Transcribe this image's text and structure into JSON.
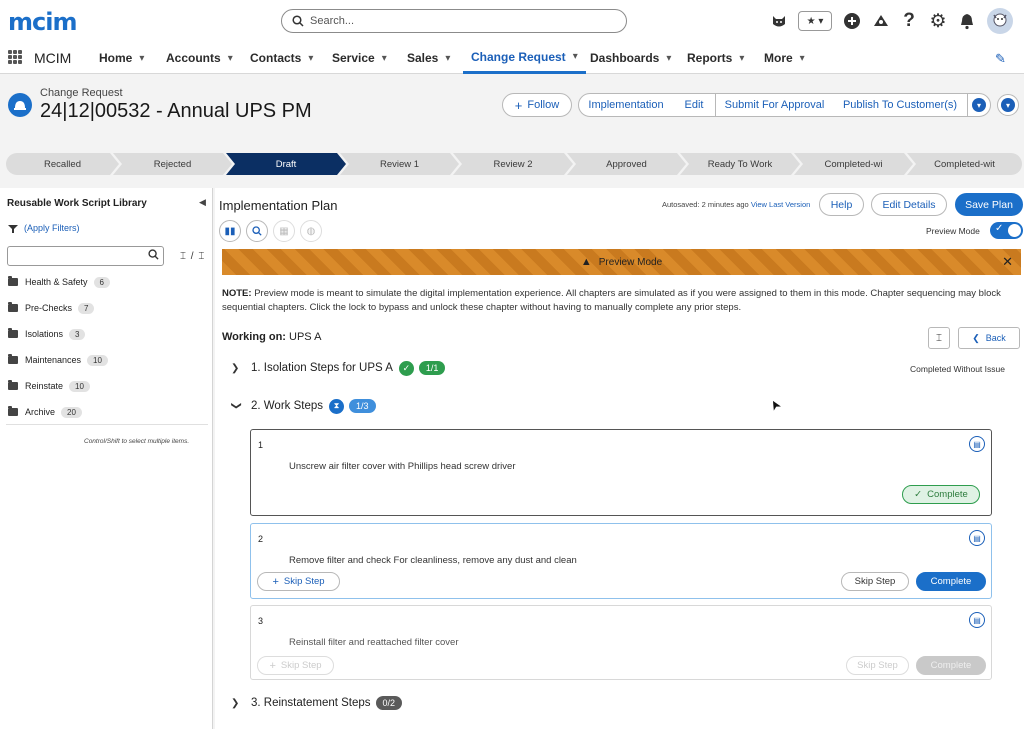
{
  "app": {
    "logo": "mcim",
    "name": "MCIM",
    "search_placeholder": "Search..."
  },
  "header_icons": [
    "cat-avatar-icon",
    "favorites-star-icon",
    "add-icon",
    "trailhead-icon",
    "help-icon",
    "settings-gear-icon",
    "notifications-bell-icon",
    "user-avatar-icon"
  ],
  "nav": {
    "items": [
      {
        "label": "Home"
      },
      {
        "label": "Accounts"
      },
      {
        "label": "Contacts"
      },
      {
        "label": "Service"
      },
      {
        "label": "Sales"
      },
      {
        "label": "Change Request",
        "active": true
      },
      {
        "label": "Dashboards"
      },
      {
        "label": "Reports"
      },
      {
        "label": "More"
      }
    ]
  },
  "record": {
    "object_label": "Change Request",
    "title": "24|12|00532 - Annual UPS PM",
    "actions": {
      "follow": "Follow",
      "implementation": "Implementation",
      "edit": "Edit",
      "submit": "Submit For Approval",
      "publish": "Publish To Customer(s)"
    }
  },
  "path": {
    "steps": [
      "Recalled",
      "Rejected",
      "Draft",
      "Review 1",
      "Review 2",
      "Approved",
      "Ready To Work",
      "Completed-wi",
      "Completed-wit"
    ],
    "current": "Draft"
  },
  "sidebar": {
    "title": "Reusable Work Script Library",
    "apply_filters": "(Apply Filters)",
    "expand_all": "⌶ / ⌶",
    "items": [
      {
        "label": "Health & Safety",
        "count": "6"
      },
      {
        "label": "Pre-Checks",
        "count": "7"
      },
      {
        "label": "Isolations",
        "count": "3"
      },
      {
        "label": "Maintenances",
        "count": "10"
      },
      {
        "label": "Reinstate",
        "count": "10"
      },
      {
        "label": "Archive",
        "count": "20"
      }
    ],
    "hint": "Control/Shift to select multiple items."
  },
  "plan": {
    "title": "Implementation Plan",
    "autosaved": "Autosaved: 2 minutes ago",
    "view_last_version": "View Last Version",
    "help": "Help",
    "edit_details": "Edit Details",
    "save_plan": "Save Plan",
    "preview_mode_label": "Preview Mode",
    "preview_mode_on": true,
    "banner": "Preview Mode",
    "note_prefix": "NOTE:",
    "note": " Preview mode is meant to simulate the digital implementation experience. All chapters are simulated as if you were assigned to them in this mode. Chapter sequencing may block sequential chapters. Click the lock to bypass and unlock these chapter without having to manually complete any prior steps.",
    "working_on_label": "Working on:",
    "working_on_value": "UPS A",
    "back": "Back"
  },
  "chapters": [
    {
      "title": "1. Isolation Steps for UPS A",
      "progress": "1/1",
      "status": "Completed Without Issue"
    },
    {
      "title": "2. Work Steps",
      "progress": "1/3"
    },
    {
      "title": "3. Reinstatement Steps",
      "progress": "0/2"
    }
  ],
  "steps": [
    {
      "num": "1",
      "text": "Unscrew air filter cover with Phillips head screw driver",
      "complete_label": "Complete"
    },
    {
      "num": "2",
      "text": "Remove filter and check For cleanliness, remove any dust and clean",
      "skip_step_add": "Skip Step",
      "skip_step": "Skip Step",
      "complete_label": "Complete"
    },
    {
      "num": "3",
      "text": "Reinstall filter and reattached filter cover",
      "skip_step_add": "Skip Step",
      "skip_step": "Skip Step",
      "complete_label": "Complete"
    }
  ],
  "colors": {
    "brand": "#1b6fc9",
    "path_current": "#0b2f63",
    "banner": "#d98a2a",
    "success": "#2e9d4e"
  }
}
